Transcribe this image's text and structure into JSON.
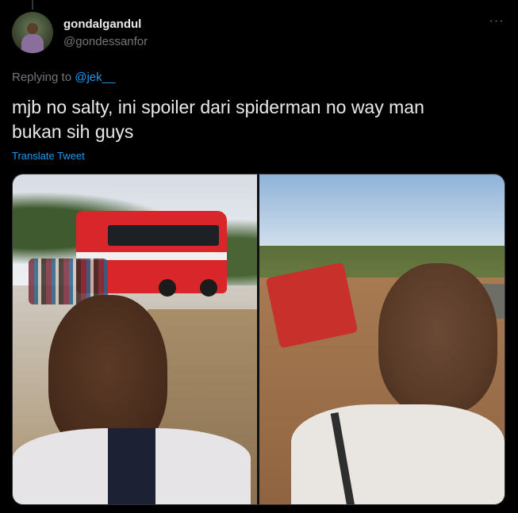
{
  "tweet": {
    "author": {
      "display_name": "gondalgandul",
      "handle": "@gondessanfor"
    },
    "more_menu": "···",
    "reply": {
      "prefix": "Replying to ",
      "mention": "@jek__"
    },
    "text_line1": "mjb no salty, ini spoiler dari spiderman no way man",
    "text_line2": "bukan sih guys",
    "translate_label": "Translate Tweet"
  },
  "colors": {
    "background": "#000000",
    "text_primary": "#e7e9ea",
    "text_secondary": "#71767b",
    "link": "#1d9bf0"
  }
}
